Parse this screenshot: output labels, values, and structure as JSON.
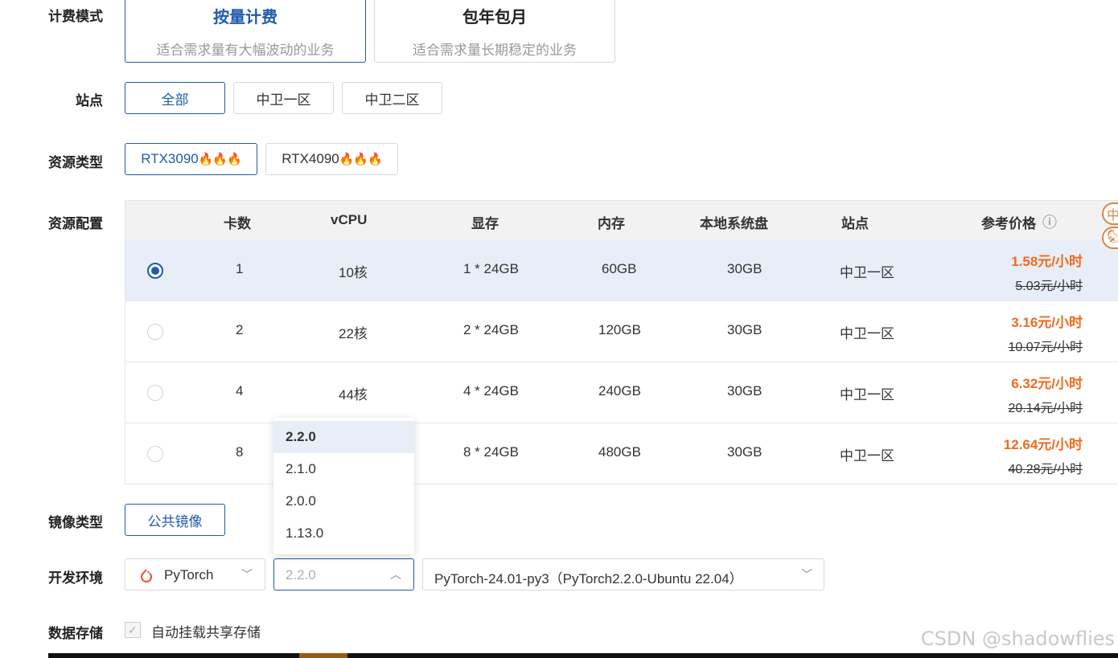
{
  "billing": {
    "label": "计费模式",
    "options": [
      {
        "title": "按量计费",
        "desc": "适合需求量有大幅波动的业务"
      },
      {
        "title": "包年包月",
        "desc": "适合需求量长期稳定的业务"
      }
    ]
  },
  "site": {
    "label": "站点",
    "options": [
      "全部",
      "中卫一区",
      "中卫二区"
    ]
  },
  "resource_type": {
    "label": "资源类型",
    "options": [
      "RTX3090",
      "RTX4090"
    ],
    "hot_icon": "🔥🔥🔥"
  },
  "resource_config": {
    "label": "资源配置",
    "headers": [
      "卡数",
      "vCPU",
      "显存",
      "内存",
      "本地系统盘",
      "站点",
      "参考价格"
    ],
    "info_icon": "ⓘ",
    "rows": [
      {
        "cards": "1",
        "vcpu": "10核",
        "gpu_mem": "1 * 24GB",
        "mem": "60GB",
        "disk": "30GB",
        "site": "中卫一区",
        "price": "1.58元/小时",
        "orig_price": "5.03元/小时"
      },
      {
        "cards": "2",
        "vcpu": "22核",
        "gpu_mem": "2 * 24GB",
        "mem": "120GB",
        "disk": "30GB",
        "site": "中卫一区",
        "price": "3.16元/小时",
        "orig_price": "10.07元/小时"
      },
      {
        "cards": "4",
        "vcpu": "44核",
        "gpu_mem": "4 * 24GB",
        "mem": "240GB",
        "disk": "30GB",
        "site": "中卫一区",
        "price": "6.32元/小时",
        "orig_price": "20.14元/小时"
      },
      {
        "cards": "8",
        "vcpu": "",
        "gpu_mem": "8 * 24GB",
        "mem": "480GB",
        "disk": "30GB",
        "site": "中卫一区",
        "price": "12.64元/小时",
        "orig_price": "40.28元/小时"
      }
    ]
  },
  "image_type": {
    "label": "镜像类型",
    "option": "公共镜像"
  },
  "dev_env": {
    "label": "开发环境",
    "framework": "PyTorch",
    "version_placeholder": "2.2.0",
    "version_options": [
      "2.2.0",
      "2.1.0",
      "2.0.0",
      "1.13.0"
    ],
    "image": "PyTorch-24.01-py3（PyTorch2.2.0-Ubuntu 22.04）"
  },
  "storage": {
    "label": "数据存储",
    "checkbox_label": "自动挂载共享存储"
  },
  "side_float": [
    "中",
    "🐿"
  ],
  "watermark": "CSDN @shadowflies",
  "colors": {
    "accent": "#1f5bac",
    "price": "#f06a1d"
  }
}
